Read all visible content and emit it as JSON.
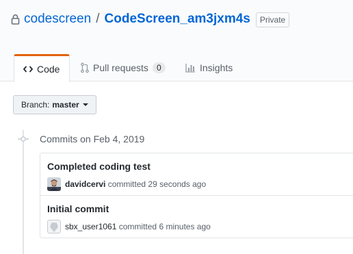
{
  "repo": {
    "owner": "codescreen",
    "separator": "/",
    "name": "CodeScreen_am3jxm4s",
    "visibility": "Private"
  },
  "tabs": [
    {
      "label": "Code",
      "icon": "code-icon",
      "selected": true
    },
    {
      "label": "Pull requests",
      "icon": "pull-request-icon",
      "counter": "0"
    },
    {
      "label": "Insights",
      "icon": "graph-icon"
    }
  ],
  "branch": {
    "label": "Branch:",
    "value": "master"
  },
  "commits": {
    "date_heading": "Commits on Feb 4, 2019",
    "items": [
      {
        "title": "Completed coding test",
        "author": "davidcervi",
        "action": "committed",
        "time": "29 seconds ago",
        "avatar": "user-photo-avatar"
      },
      {
        "title": "Initial commit",
        "author": "sbx_user1061",
        "action": "committed",
        "time": "6 minutes ago",
        "avatar": "default-github-avatar"
      }
    ]
  },
  "colors": {
    "link": "#0366d6",
    "tab_accent": "#e36209",
    "muted": "#586069"
  }
}
